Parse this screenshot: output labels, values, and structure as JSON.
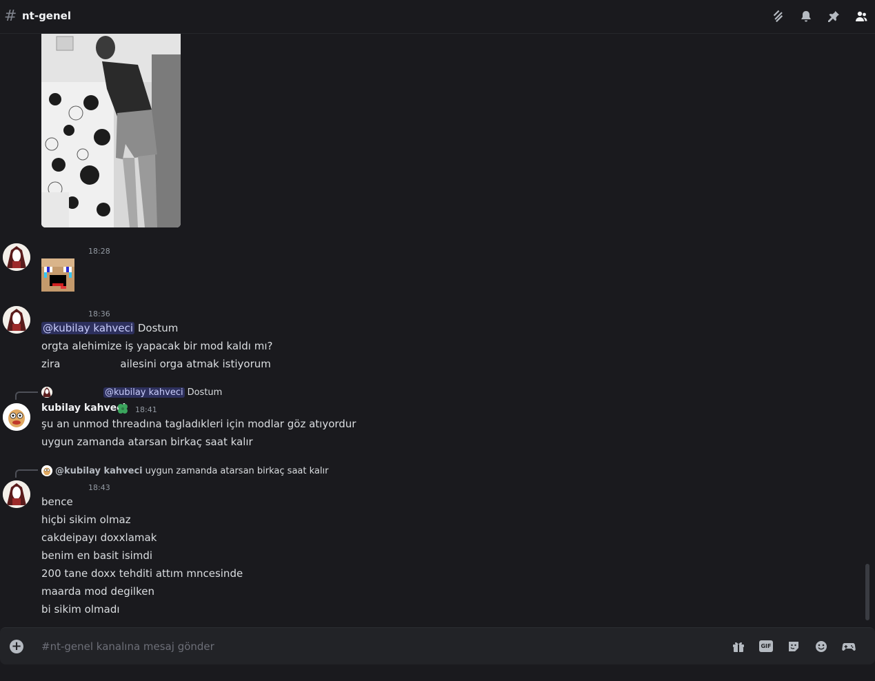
{
  "header": {
    "hash_symbol": "#",
    "channel_name": "nt-genel",
    "icons": [
      "threads-icon",
      "bell-icon",
      "pin-icon",
      "members-icon"
    ]
  },
  "messages": [
    {
      "time": "18:28",
      "emoji": "cry-laugh-pixel-face-icon"
    },
    {
      "time": "18:36",
      "mention": "@kubilay kahveci",
      "lines": [
        "Dostum",
        "orgta alehimize iş yapacak bir mod kaldı mı?",
        "zira",
        "ailesini orga atmak istiyorum"
      ]
    },
    {
      "reply_mention": "@kubilay kahveci",
      "reply_text": "Dostum",
      "username": "kubilay kahveci",
      "badge_icon": "clover-icon",
      "time": "18:41",
      "lines": [
        "şu an unmod threadına tagladıkleri için modlar göz atıyordur",
        "uygun zamanda atarsan birkaç saat kalır"
      ]
    },
    {
      "reply_mention": "@kubilay kahveci",
      "reply_text": "uygun zamanda atarsan birkaç saat kalır",
      "time": "18:43",
      "lines": [
        "bence",
        "hiçbi sikim olmaz",
        "cakdeipayı doxxlamak",
        "benim en basit isimdi",
        "200 tane doxx tehditi attım mncesinde",
        "maarda mod degilken",
        "bi sikim olmadı"
      ]
    }
  ],
  "composer": {
    "placeholder": "#nt-genel kanalına mesaj gönder",
    "gif_label": "GIF",
    "icons": [
      "plus-icon",
      "gift-icon",
      "gif-icon",
      "sticker-icon",
      "emoji-icon",
      "activities-icon"
    ]
  },
  "colors": {
    "background": "#1a1a1e",
    "mention_bg": "#3c418a",
    "mention_text": "#c9cdfb",
    "badge_green": "#3ba55d"
  }
}
